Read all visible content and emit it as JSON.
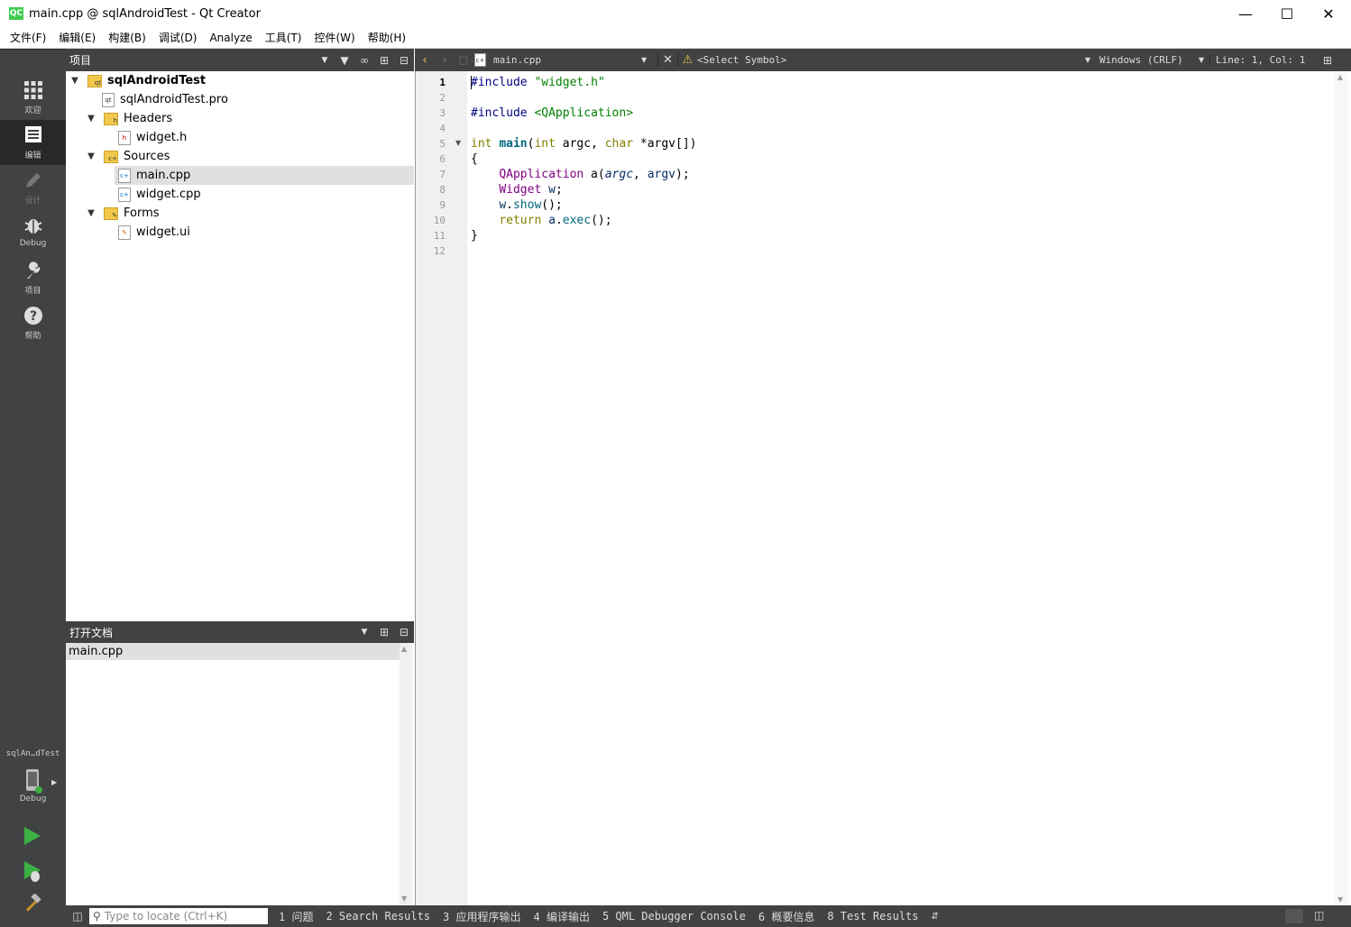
{
  "window": {
    "title": "main.cpp @ sqlAndroidTest - Qt Creator",
    "logo": "QC"
  },
  "menu": [
    "文件(F)",
    "编辑(E)",
    "构建(B)",
    "调试(D)",
    "Analyze",
    "工具(T)",
    "控件(W)",
    "帮助(H)"
  ],
  "modes": [
    {
      "label": "欢迎",
      "icon": "grid-icon"
    },
    {
      "label": "编辑",
      "icon": "document-icon"
    },
    {
      "label": "设计",
      "icon": "pencil-icon"
    },
    {
      "label": "Debug",
      "icon": "bug-icon"
    },
    {
      "label": "项目",
      "icon": "wrench-icon"
    },
    {
      "label": "帮助",
      "icon": "help-icon"
    }
  ],
  "kit": {
    "project": "sqlAn…dTest",
    "config": "Debug"
  },
  "projects_panel": {
    "title": "项目",
    "tree": [
      {
        "label": "sqlAndroidTest",
        "kind": "project",
        "bold": true,
        "expander": "▼"
      },
      {
        "label": "sqlAndroidTest.pro",
        "kind": "pro"
      },
      {
        "label": "Headers",
        "kind": "folder",
        "expander": "▼"
      },
      {
        "label": "widget.h",
        "kind": "header"
      },
      {
        "label": "Sources",
        "kind": "folder",
        "expander": "▼"
      },
      {
        "label": "main.cpp",
        "kind": "cpp",
        "selected": true
      },
      {
        "label": "widget.cpp",
        "kind": "cpp"
      },
      {
        "label": "Forms",
        "kind": "forms",
        "expander": "▼"
      },
      {
        "label": "widget.ui",
        "kind": "ui"
      }
    ]
  },
  "open_documents": {
    "title": "打开文档",
    "items": [
      "main.cpp"
    ]
  },
  "editor": {
    "file": "main.cpp",
    "symbol": "<Select Symbol>",
    "line_endings": "Windows (CRLF)",
    "position": "Line: 1, Col: 1",
    "line_numbers": [
      "1",
      "2",
      "3",
      "4",
      "5",
      "6",
      "7",
      "8",
      "9",
      "10",
      "11",
      "12"
    ],
    "code": {
      "l1_a": "#include",
      "l1_b": "\"widget.h\"",
      "l3_a": "#include",
      "l3_b": "<QApplication>",
      "l5_a": "int",
      "l5_b": "main",
      "l5_c": "(",
      "l5_d": "int",
      "l5_e": " argc, ",
      "l5_f": "char",
      "l5_g": " *argv[])",
      "l6": "{",
      "l7_a": "    ",
      "l7_b": "QApplication",
      "l7_c": " a(",
      "l7_d": "argc",
      "l7_e": ", ",
      "l7_f": "argv",
      "l7_g": ");",
      "l8_a": "    ",
      "l8_b": "Widget",
      "l8_c": " ",
      "l8_d": "w",
      "l8_e": ";",
      "l9_a": "    ",
      "l9_b": "w",
      "l9_c": ".",
      "l9_d": "show",
      "l9_e": "();",
      "l10_a": "    ",
      "l10_b": "return",
      "l10_c": " ",
      "l10_d": "a",
      "l10_e": ".",
      "l10_f": "exec",
      "l10_g": "();",
      "l11": "}"
    }
  },
  "statusbar": {
    "locator_placeholder": "Type to locate (Ctrl+K)",
    "tabs": [
      "1 问题",
      "2 Search Results",
      "3 应用程序输出",
      "4 编译输出",
      "5 QML Debugger Console",
      "6 概要信息",
      "8 Test Results"
    ]
  },
  "colors": {
    "sidebar": "#404244",
    "sidebar_active": "#262829",
    "run_green": "#3cb043",
    "selection": "#e0e0e0"
  }
}
